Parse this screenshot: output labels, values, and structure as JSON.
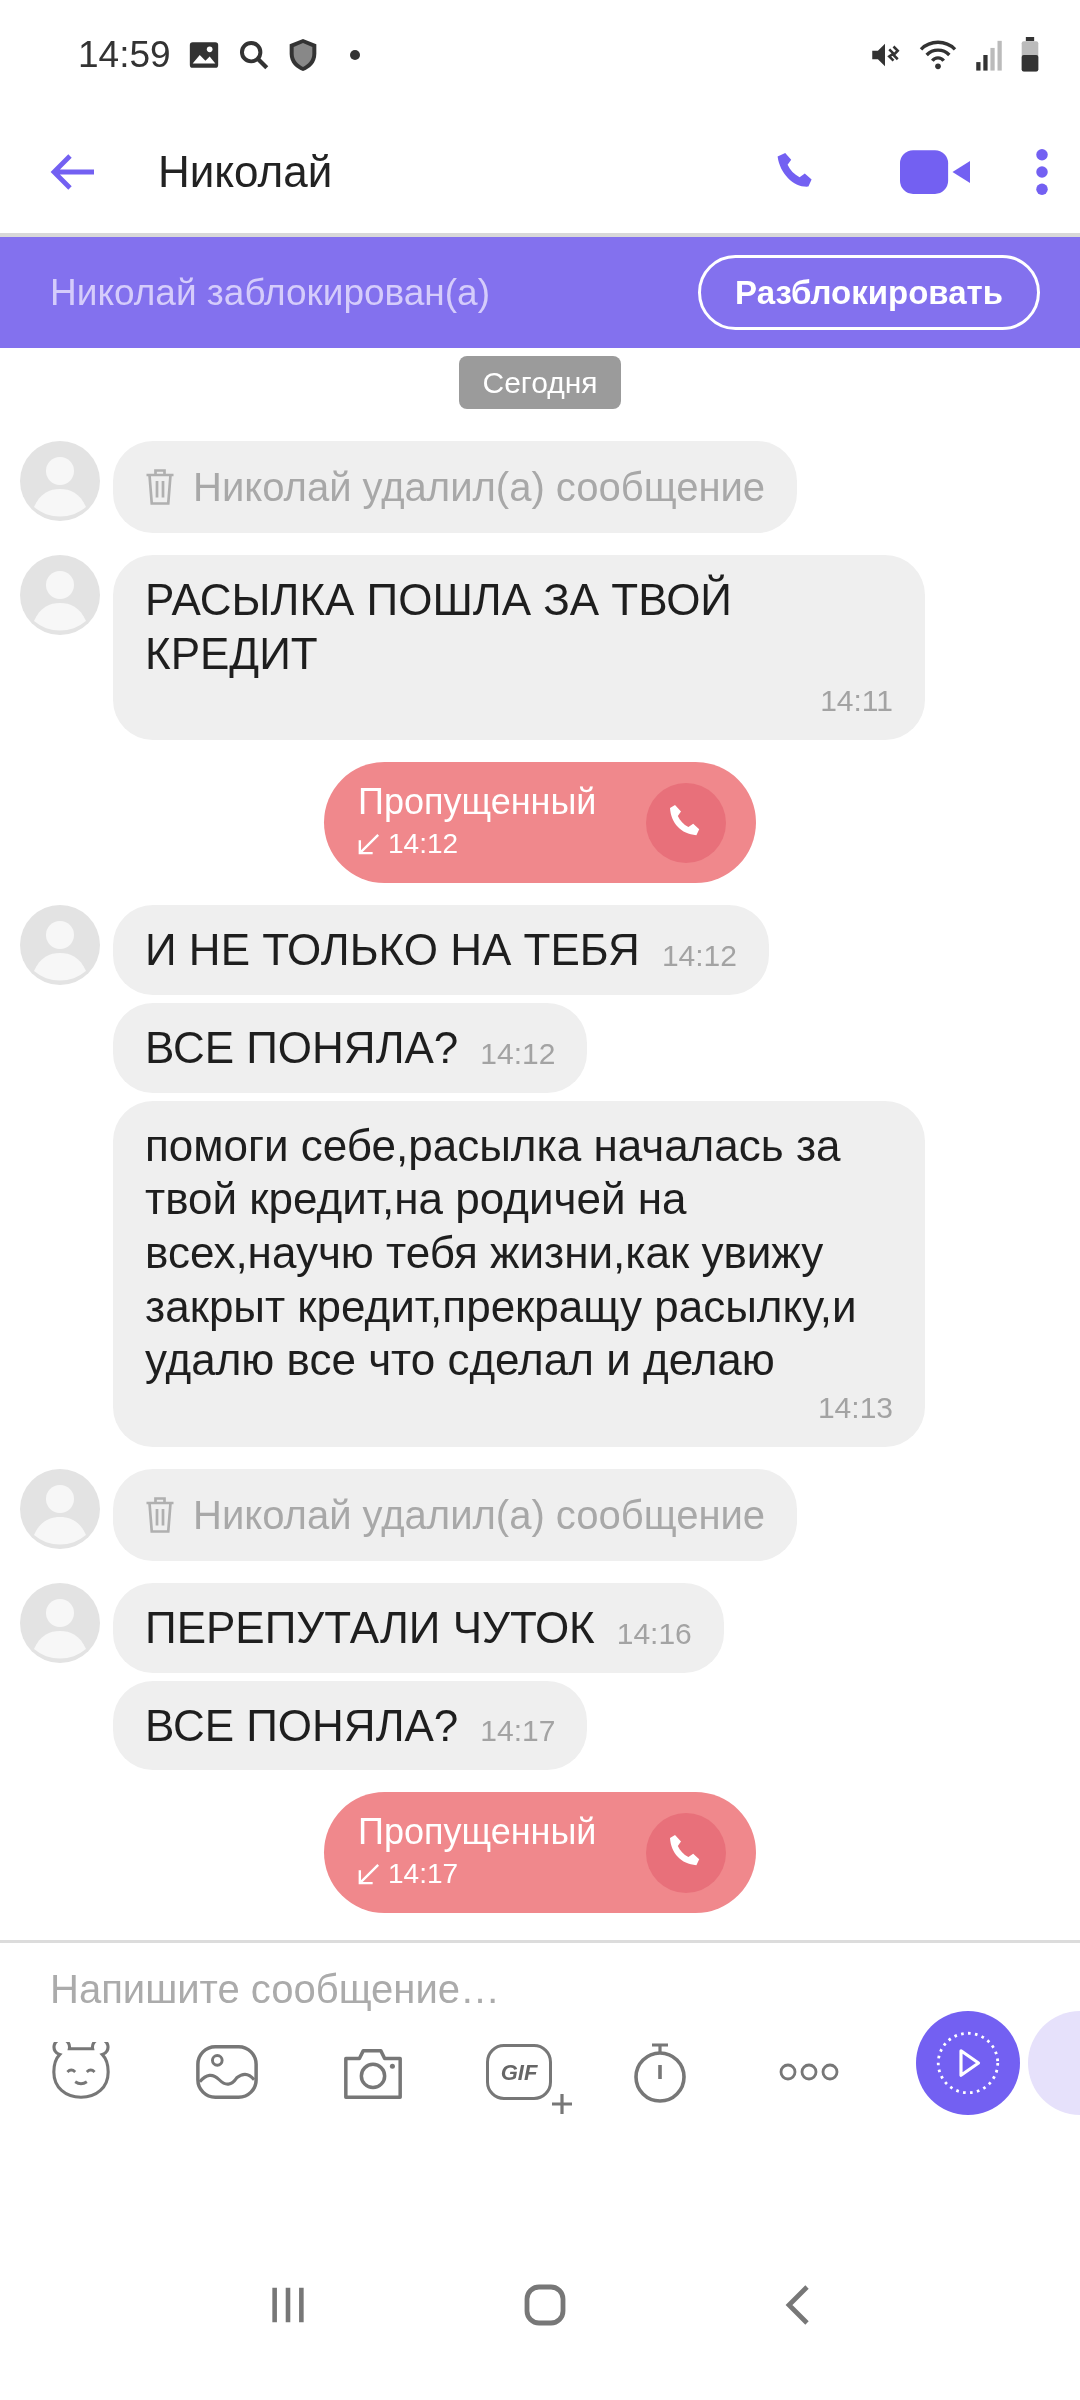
{
  "status_bar": {
    "time": "14:59"
  },
  "header": {
    "title": "Николай"
  },
  "blocked_banner": {
    "text": "Николай заблокирован(а)",
    "button": "Разблокировать"
  },
  "date_divider": "Сегодня",
  "messages": [
    {
      "kind": "deleted",
      "avatar": true,
      "text": "Николай удалил(а) сообщение"
    },
    {
      "kind": "text",
      "avatar": true,
      "text": "РАСЫЛКА ПОШЛА ЗА ТВОЙ КРЕДИТ",
      "time": "14:11"
    },
    {
      "kind": "missed_call",
      "label": "Пропущенный",
      "time": "14:12"
    },
    {
      "kind": "text",
      "avatar": true,
      "text": "И НЕ ТОЛЬКО НА ТЕБЯ",
      "time": "14:12"
    },
    {
      "kind": "text",
      "avatar": false,
      "text": "ВСЕ ПОНЯЛА?",
      "time": "14:12"
    },
    {
      "kind": "text",
      "avatar": false,
      "text": "помоги себе,расылка началась за твой кредит,на родичей на всех,научю тебя жизни,как увижу закрыт кредит,прекращу расылку,и удалю все что сделал и делаю",
      "time": "14:13"
    },
    {
      "kind": "deleted",
      "avatar": true,
      "text": "Николай удалил(а) сообщение"
    },
    {
      "kind": "text",
      "avatar": true,
      "text": "ПЕРЕПУТАЛИ ЧУТОК",
      "time": "14:16"
    },
    {
      "kind": "text",
      "avatar": false,
      "text": "ВСЕ ПОНЯЛА?",
      "time": "14:17"
    },
    {
      "kind": "missed_call",
      "label": "Пропущенный",
      "time": "14:17"
    }
  ],
  "composer": {
    "placeholder": "Напишите сообщение…",
    "gif_label": "GIF"
  }
}
